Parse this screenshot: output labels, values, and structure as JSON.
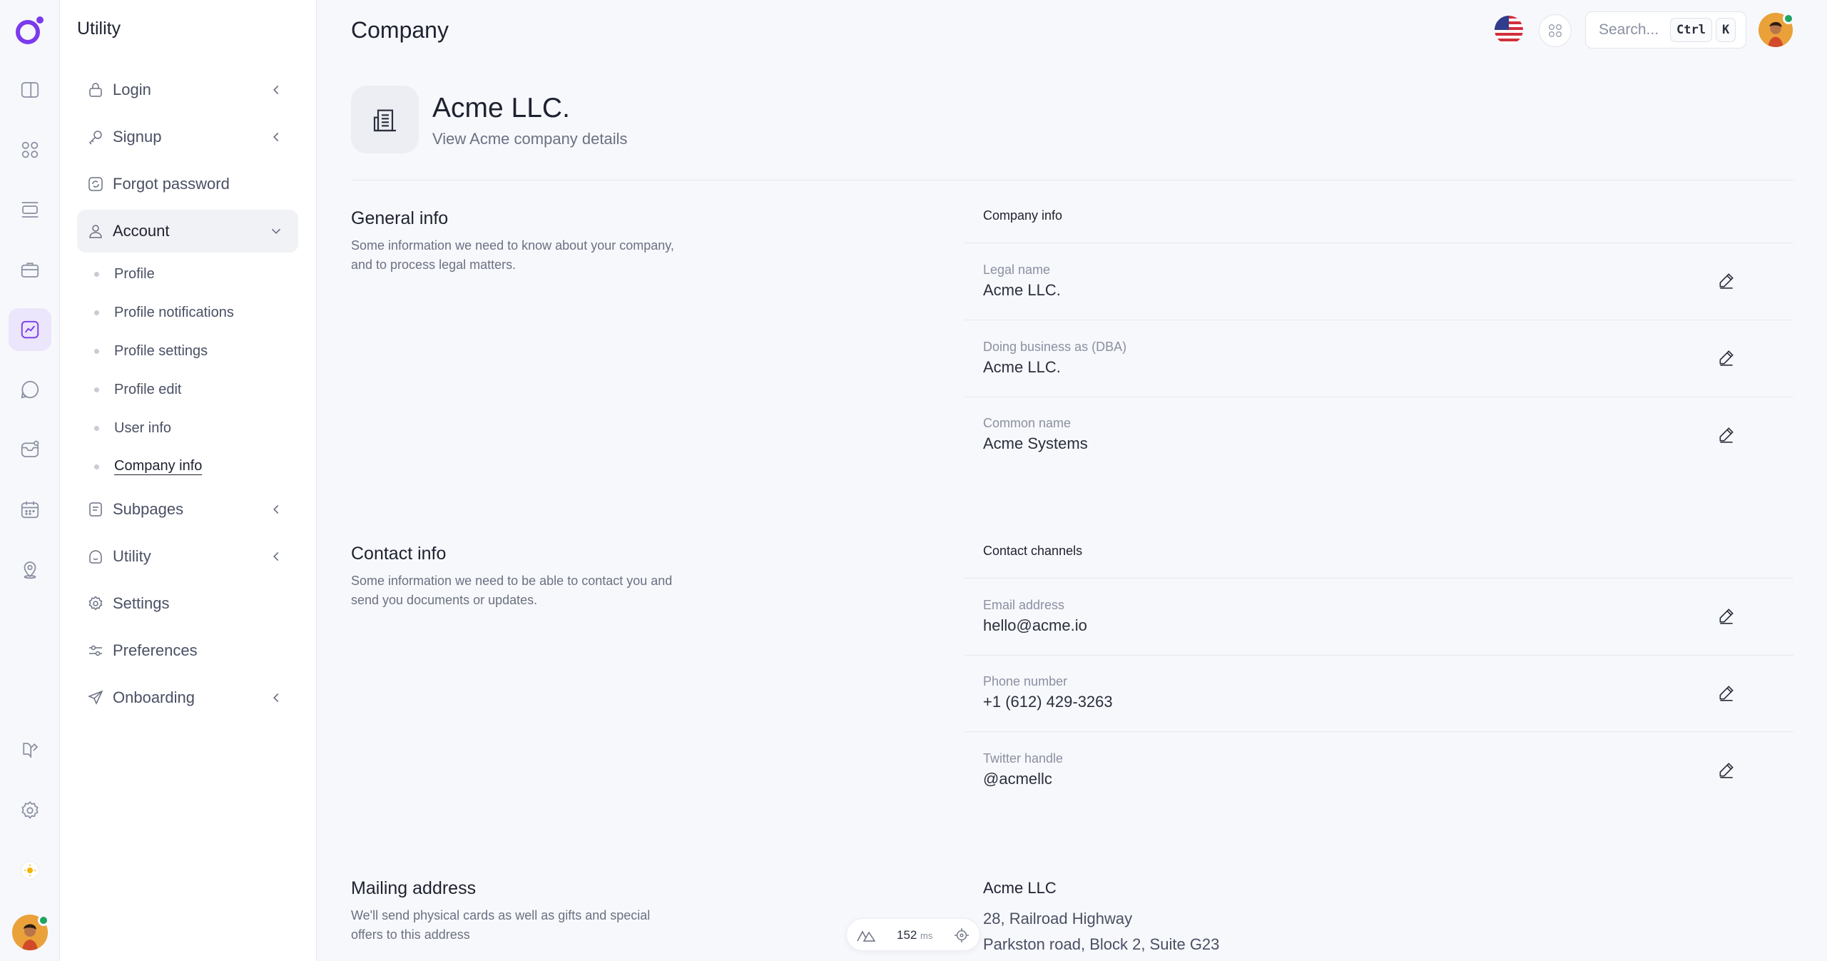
{
  "sidebar": {
    "title": "Utility",
    "items": [
      {
        "label": "Login"
      },
      {
        "label": "Signup"
      },
      {
        "label": "Forgot password"
      },
      {
        "label": "Account"
      },
      {
        "label": "Subpages"
      },
      {
        "label": "Utility"
      },
      {
        "label": "Settings"
      },
      {
        "label": "Preferences"
      },
      {
        "label": "Onboarding"
      }
    ],
    "account_sub": [
      {
        "label": "Profile"
      },
      {
        "label": "Profile notifications"
      },
      {
        "label": "Profile settings"
      },
      {
        "label": "Profile edit"
      },
      {
        "label": "User info"
      },
      {
        "label": "Company info"
      }
    ]
  },
  "header": {
    "title": "Company",
    "search_placeholder": "Search...",
    "shortcut_ctrl": "Ctrl",
    "shortcut_k": "K"
  },
  "company": {
    "name": "Acme LLC.",
    "subtitle": "View Acme company details"
  },
  "general": {
    "title": "General info",
    "description": "Some information we need to know about your company, and to process legal matters.",
    "card_title": "Company info",
    "fields": [
      {
        "label": "Legal name",
        "value": "Acme LLC."
      },
      {
        "label": "Doing business as (DBA)",
        "value": "Acme LLC."
      },
      {
        "label": "Common name",
        "value": "Acme Systems"
      }
    ]
  },
  "contact": {
    "title": "Contact info",
    "description": "Some information we need to be able to contact you and send you documents or updates.",
    "card_title": "Contact channels",
    "fields": [
      {
        "label": "Email address",
        "value": "hello@acme.io"
      },
      {
        "label": "Phone number",
        "value": "+1 (612) 429-3263"
      },
      {
        "label": "Twitter handle",
        "value": "@acmellc"
      }
    ]
  },
  "mailing": {
    "title": "Mailing address",
    "description": "We'll send physical cards as well as gifts and special offers to this address",
    "name": "Acme LLC",
    "line1": "28, Railroad Highway",
    "line2": "Parkston road, Block 2, Suite G23"
  },
  "perf": {
    "value": "152",
    "unit": "ms"
  },
  "colors": {
    "accent": "#7c3aed",
    "active_bg": "#ebe6fb",
    "status_online": "#1fa463"
  }
}
